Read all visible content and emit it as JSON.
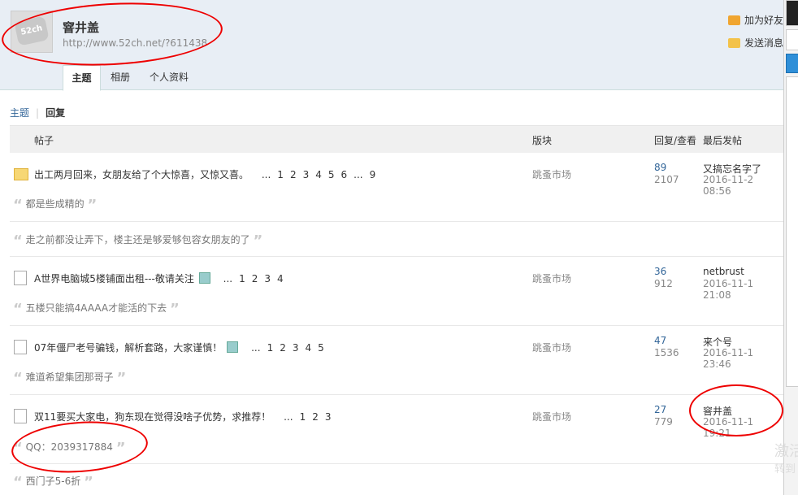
{
  "profile": {
    "avatar_text": "52ch",
    "username": "窨井盖",
    "url": "http://www.52ch.net/?611438"
  },
  "actions": {
    "add_friend": "加为好友",
    "send_message": "发送消息"
  },
  "tabs": [
    "主题",
    "相册",
    "个人资料"
  ],
  "subnav": [
    "主题",
    "回复"
  ],
  "table_header": {
    "post": "帖子",
    "forum": "版块",
    "reply_view": "回复/查看",
    "last_post": "最后发帖"
  },
  "threads": [
    {
      "title": "出工两月回来，女朋友给了个大惊喜，又惊又喜。",
      "pages": [
        "...",
        "1",
        "2",
        "3",
        "4",
        "5",
        "6",
        "...",
        "9"
      ],
      "forum": "跳蚤市场",
      "replies": "89",
      "views": "2107",
      "last_user": "又搞忘名字了",
      "last_time": "2016-11-2 08:56",
      "quotes": [
        "都是些成精的",
        "走之前都没让弄下，楼主还是够爱够包容女朋友的了"
      ]
    },
    {
      "title": "A世界电脑城5楼铺面出租---敬请关注",
      "pages": [
        "...",
        "1",
        "2",
        "3",
        "4"
      ],
      "forum": "跳蚤市场",
      "replies": "36",
      "views": "912",
      "last_user": "netbrust",
      "last_time": "2016-11-1 21:08",
      "quotes": [
        "五楼只能搞4AAAA才能活的下去"
      ]
    },
    {
      "title": "07年僵尸老号骗钱，解析套路，大家谨慎！",
      "pages": [
        "...",
        "1",
        "2",
        "3",
        "4",
        "5"
      ],
      "forum": "跳蚤市场",
      "replies": "47",
      "views": "1536",
      "last_user": "来个号",
      "last_time": "2016-11-1 23:46",
      "quotes": [
        "难道希望集团那哥子"
      ]
    },
    {
      "title": "双11要买大家电，狗东现在觉得没啥子优势，求推荐！",
      "pages": [
        "...",
        "1",
        "2",
        "3"
      ],
      "forum": "跳蚤市场",
      "replies": "27",
      "views": "779",
      "last_user": "窨井盖",
      "last_time": "2016-11-1 19:21",
      "quotes": [
        "QQ：2039317884",
        "西门子5-6折"
      ]
    }
  ],
  "overlay": {
    "watermark_1": "激活",
    "watermark_2": "转到"
  },
  "colors": {
    "header_bg": "#e8eef5",
    "link_blue": "#336699",
    "annotation_red": "#e00000"
  }
}
